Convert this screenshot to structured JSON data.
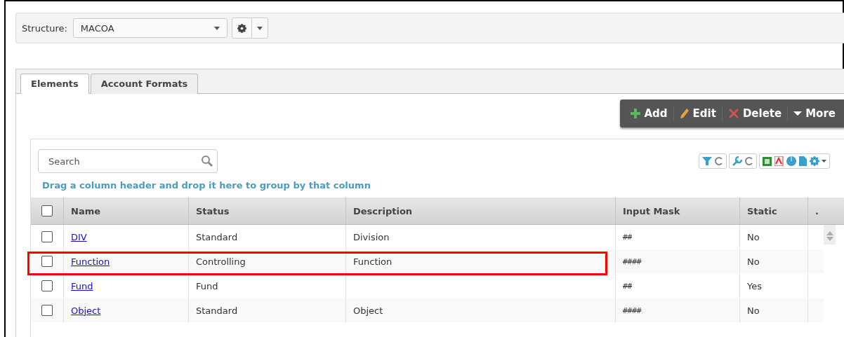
{
  "structure": {
    "label": "Structure:",
    "value": "MACOA"
  },
  "tabs": [
    {
      "label": "Elements",
      "selected": true
    },
    {
      "label": "Account Formats",
      "selected": false
    }
  ],
  "actions": [
    {
      "kind": "add",
      "label": "Add"
    },
    {
      "kind": "edit",
      "label": "Edit"
    },
    {
      "kind": "delete",
      "label": "Delete"
    },
    {
      "kind": "more",
      "label": "More"
    }
  ],
  "search": {
    "placeholder": "Search"
  },
  "group_hint": "Drag a column header and drop it here to group by that column",
  "table": {
    "header_checked": false,
    "columns": [
      "Name",
      "Status",
      "Description",
      "Input Mask",
      "Static",
      "."
    ],
    "rows": [
      {
        "checked": false,
        "highlighted": false,
        "cells": [
          "DIV",
          "Standard",
          "Division",
          "##",
          "No"
        ]
      },
      {
        "checked": false,
        "highlighted": true,
        "cells": [
          "Function",
          "Controlling",
          "Function",
          "####",
          "No"
        ]
      },
      {
        "checked": false,
        "highlighted": false,
        "cells": [
          "Fund",
          "Fund",
          "",
          "##",
          "Yes"
        ]
      },
      {
        "checked": false,
        "highlighted": false,
        "cells": [
          "Object",
          "Standard",
          "Object",
          "####",
          "No"
        ]
      }
    ]
  }
}
